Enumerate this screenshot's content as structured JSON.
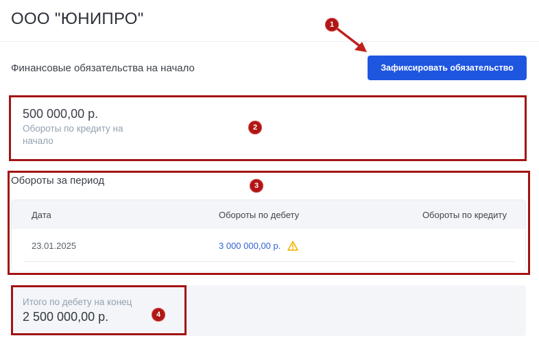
{
  "header": {
    "company_name": "ООО \"ЮНИПРО\""
  },
  "section": {
    "title": "Финансовые обязательства на начало",
    "fix_button_label": "Зафиксировать обязательство"
  },
  "opening_balance": {
    "amount": "500 000,00 р.",
    "label": "Обороты по кредиту на начало"
  },
  "period": {
    "title": "Обороты за период",
    "columns": {
      "date": "Дата",
      "debit": "Обороты по дебету",
      "credit": "Обороты по кредиту"
    },
    "rows": [
      {
        "date": "23.01.2025",
        "debit": "3 000 000,00 р.",
        "credit": "",
        "warning_icon": "warning-triangle-icon"
      }
    ]
  },
  "closing": {
    "label": "Итого по дебету на конец",
    "amount": "2 500 000,00 р."
  },
  "annotations": [
    "1",
    "2",
    "3",
    "4"
  ],
  "colors": {
    "primary": "#1f56e0",
    "link": "#2f63d6",
    "warning": "#f0b400",
    "annotation": "#a31212"
  }
}
